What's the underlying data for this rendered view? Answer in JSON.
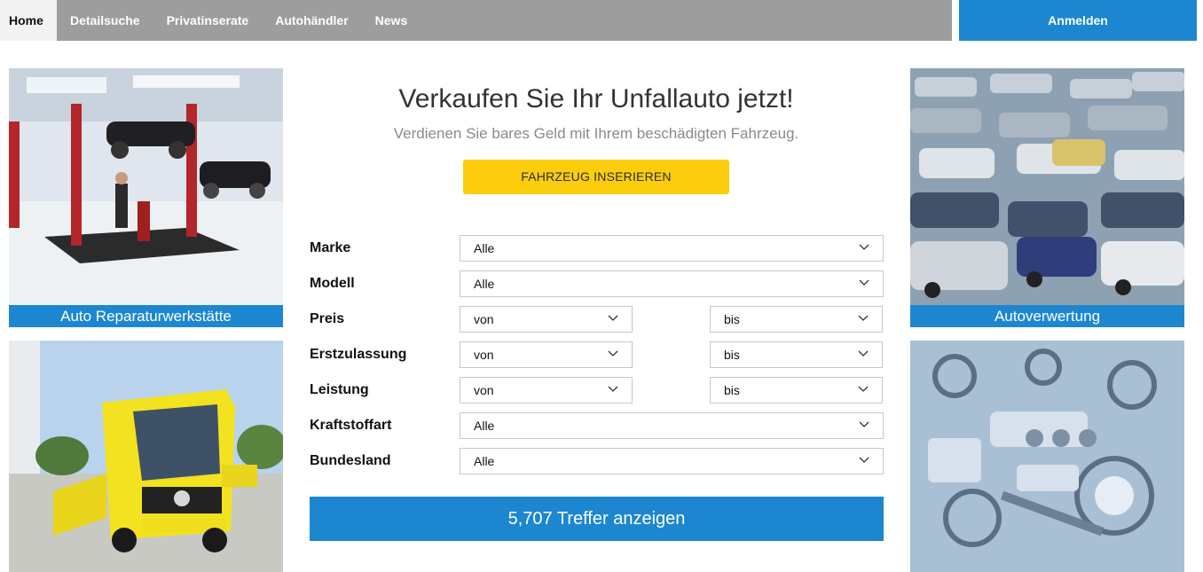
{
  "nav": {
    "items": [
      "Home",
      "Detailsuche",
      "Privatinserate",
      "Autohändler",
      "News"
    ],
    "login_label": "Anmelden"
  },
  "hero": {
    "title": "Verkaufen Sie Ihr Unfallauto jetzt!",
    "subtitle": "Verdienen Sie bares Geld mit Ihrem beschädigten Fahrzeug.",
    "cta_label": "FAHRZEUG INSERIEREN"
  },
  "tiles": {
    "workshop": "Auto Reparaturwerkstätte",
    "recycling": "Autoverwertung"
  },
  "form": {
    "marke": {
      "label": "Marke",
      "value": "Alle"
    },
    "modell": {
      "label": "Modell",
      "value": "Alle"
    },
    "preis": {
      "label": "Preis",
      "from": "von",
      "to": "bis"
    },
    "erstzulassung": {
      "label": "Erstzulassung",
      "from": "von",
      "to": "bis"
    },
    "leistung": {
      "label": "Leistung",
      "from": "von",
      "to": "bis"
    },
    "kraftstoffart": {
      "label": "Kraftstoffart",
      "value": "Alle"
    },
    "bundesland": {
      "label": "Bundesland",
      "value": "Alle"
    },
    "submit_label": "5,707 Treffer anzeigen"
  },
  "colors": {
    "brand_blue": "#1c87d0",
    "cta_yellow": "#fbcd0d",
    "nav_gray": "#9d9d9d"
  }
}
